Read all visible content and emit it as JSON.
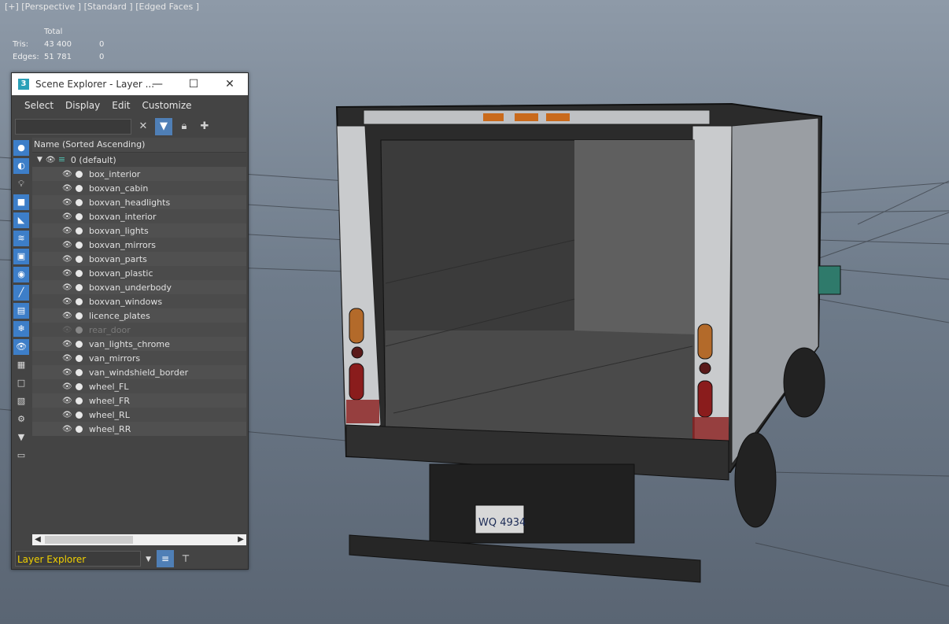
{
  "viewport": {
    "label": "[+] [Perspective ] [Standard ] [Edged Faces ]",
    "stats": {
      "header": "Total",
      "tris_label": "Tris:",
      "tris_total": "43 400",
      "tris_sel": "0",
      "edges_label": "Edges:",
      "edges_total": "51 781",
      "edges_sel": "0"
    },
    "license_plate": "WQ 4934"
  },
  "scene_explorer": {
    "title": "Scene Explorer - Layer ...",
    "menu": [
      "Select",
      "Display",
      "Edit",
      "Customize"
    ],
    "search_value": "",
    "column_header": "Name (Sorted Ascending)",
    "root_layer": "0 (default)",
    "layers": [
      "box_interior",
      "boxvan_cabin",
      "boxvan_headlights",
      "boxvan_interior",
      "boxvan_lights",
      "boxvan_mirrors",
      "boxvan_parts",
      "boxvan_plastic",
      "boxvan_underbody",
      "boxvan_windows",
      "licence_plates",
      "rear_door",
      "van_lights_chrome",
      "van_mirrors",
      "van_windshield_border",
      "wheel_FL",
      "wheel_FR",
      "wheel_RL",
      "wheel_RR"
    ],
    "hidden_layer": "rear_door",
    "explorer_mode": "Layer Explorer"
  },
  "colors": {
    "panel_bg": "#444444",
    "accent": "#4f7fb6",
    "mode_text": "#f0d000"
  }
}
